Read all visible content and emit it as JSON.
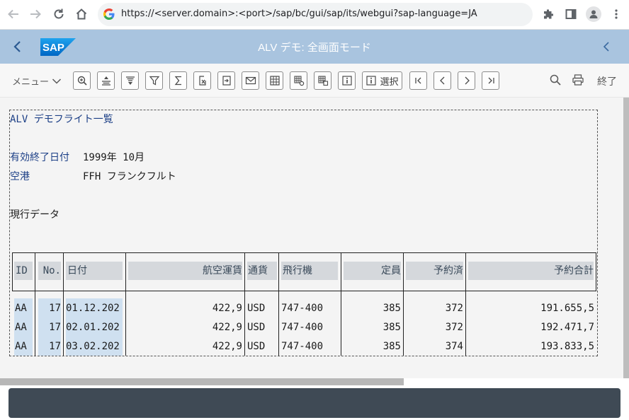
{
  "browser": {
    "url": "https://<server.domain>:<port>/sap/bc/gui/sap/its/webgui?sap-language=JA"
  },
  "header": {
    "title": "ALV デモ: 全画面モード",
    "logo_text": "SAP"
  },
  "toolbar": {
    "menu_label": "メニュー",
    "select_label": "選択",
    "end_label": "終了"
  },
  "report": {
    "title": "ALV デモフライト一覧",
    "date_label": "有効終了日付",
    "date_value": "1999年 10月",
    "airport_label": "空港",
    "airport_value": "FFH フランクフルト",
    "data_label": "現行データ",
    "columns": [
      "ID",
      "No.",
      "日付",
      "航空運賃",
      "通貨",
      "飛行機",
      "定員",
      "予約済",
      "予約合計"
    ],
    "rows": [
      [
        "AA",
        "17",
        "01.12.202",
        "422,9",
        "USD",
        "747-400",
        "385",
        "372",
        "191.655,5"
      ],
      [
        "AA",
        "17",
        "02.01.202",
        "422,9",
        "USD",
        "747-400",
        "385",
        "372",
        "192.471,7"
      ],
      [
        "AA",
        "17",
        "03.02.202",
        "422,9",
        "USD",
        "747-400",
        "385",
        "374",
        "193.833,5"
      ]
    ]
  }
}
